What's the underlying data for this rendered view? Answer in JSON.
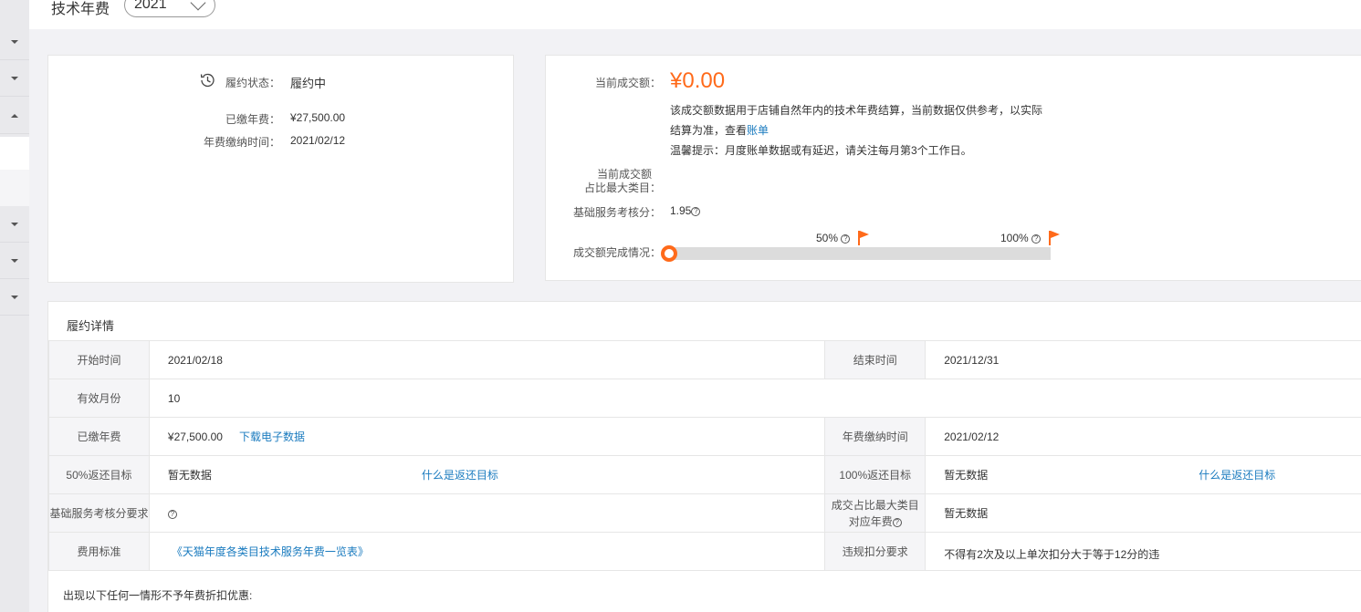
{
  "header": {
    "title": "技术年费",
    "year": "2021"
  },
  "status_card": {
    "status_label": "履约状态：",
    "status_value": "履约中",
    "paid_label": "已缴年费：",
    "paid_value": "¥27,500.00",
    "pay_time_label": "年费缴纳时间：",
    "pay_time_value": "2021/02/12"
  },
  "trade_card": {
    "amount_label": "当前成交额：",
    "amount_value": "¥0.00",
    "desc_line1": "该成交额数据用于店铺自然年内的技术年费结算，当前数据仅供参考，以实际",
    "desc_line2": "结算为准，查看",
    "bill_link": "账单",
    "desc_line3": "温馨提示：月度账单数据或有延迟，请关注每月第3个工作日。",
    "category_label_1": "当前成交额",
    "category_label_2": "占比最大类目：",
    "score_label": "基础服务考核分：",
    "score_value": "1.95",
    "progress_label": "成交额完成情况：",
    "progress_fraction": 0,
    "mark_50": "50%",
    "mark_100": "100%"
  },
  "detail": {
    "title": "履约详情",
    "start_label": "开始时间",
    "start_value": "2021/02/18",
    "end_label": "结束时间",
    "end_value": "2021/12/31",
    "months_label": "有效月份",
    "months_value": "10",
    "paid_label": "已缴年费",
    "paid_value": "¥27,500.00",
    "download_link": "下载电子数据",
    "pay_time_label": "年费缴纳时间",
    "pay_time_value": "2021/02/12",
    "target50_label": "50%返还目标",
    "target50_value": "暂无数据",
    "what_is_link": "什么是返还目标",
    "target100_label": "100%返还目标",
    "target100_value": "暂无数据",
    "score_req_label": "基础服务考核分要求",
    "cat_fee_label_1": "成交占比最大类目",
    "cat_fee_label_2": "对应年费",
    "cat_fee_value": "暂无数据",
    "fee_std_label": "费用标准",
    "fee_std_link": "《天猫年度各类目技术服务年费一览表》",
    "violation_label": "违规扣分要求",
    "violation_value": "不得有2次及以上单次扣分大于等于12分的违规",
    "note": "出现以下任何一情形不予年费折扣优惠:"
  },
  "colors": {
    "accent": "#ff6a1a",
    "link": "#1a7bbf"
  }
}
